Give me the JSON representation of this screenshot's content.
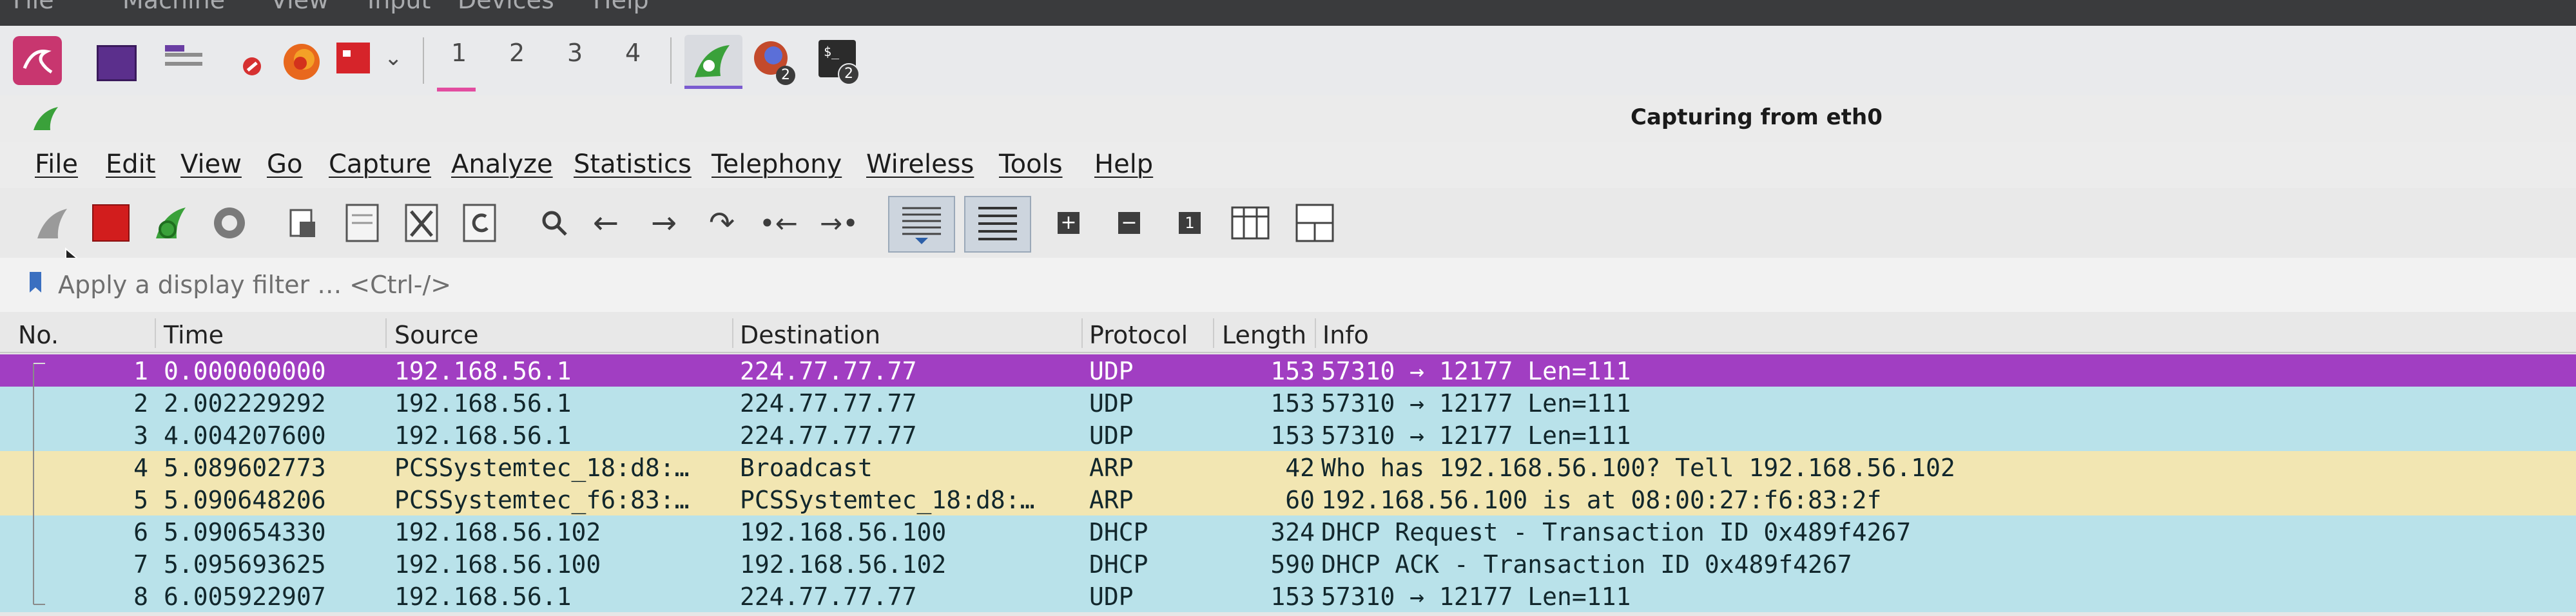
{
  "host_menu": {
    "items": [
      "File",
      "Machine",
      "View",
      "Input",
      "Devices",
      "Help"
    ]
  },
  "taskbar": {
    "workspaces": [
      "1",
      "2",
      "3",
      "4"
    ],
    "badges": [
      "2",
      "2"
    ],
    "icons": [
      "kali-menu-icon",
      "terminal-window-icon",
      "file-manager-icon",
      "text-editor-icon",
      "firefox-icon",
      "app-red-icon",
      "chevron-down-icon",
      "wireshark-task-icon",
      "firefox-task-icon",
      "terminal-task-icon"
    ]
  },
  "window": {
    "title": "Capturing from eth0"
  },
  "menu": {
    "items": [
      "File",
      "Edit",
      "View",
      "Go",
      "Capture",
      "Analyze",
      "Statistics",
      "Telephony",
      "Wireless",
      "Tools",
      "Help"
    ]
  },
  "toolbar": {
    "buttons": [
      "start-capture",
      "stop-capture",
      "restart-capture",
      "capture-options",
      "open-file",
      "save-file",
      "close-file",
      "reload-file",
      "find-packet",
      "go-back",
      "go-forward",
      "go-to-packet",
      "first-packet",
      "last-packet",
      "auto-scroll",
      "colorize",
      "zoom-in",
      "zoom-out",
      "normal-size",
      "resize-columns",
      "layout"
    ]
  },
  "filter": {
    "placeholder": "Apply a display filter … <Ctrl-/>"
  },
  "packet_list": {
    "headers": {
      "no": "No.",
      "time": "Time",
      "source": "Source",
      "destination": "Destination",
      "protocol": "Protocol",
      "length": "Length",
      "info": "Info"
    },
    "rows": [
      {
        "no": "1",
        "time": "0.000000000",
        "source": "192.168.56.1",
        "destination": "224.77.77.77",
        "protocol": "UDP",
        "length": "153",
        "info": "57310 → 12177 Len=111",
        "bg": "#a13ec2",
        "fg": "#ffffff",
        "selected": true
      },
      {
        "no": "2",
        "time": "2.002229292",
        "source": "192.168.56.1",
        "destination": "224.77.77.77",
        "protocol": "UDP",
        "length": "153",
        "info": "57310 → 12177 Len=111",
        "bg": "#b9e2ea",
        "fg": "#12272c",
        "selected": false
      },
      {
        "no": "3",
        "time": "4.004207600",
        "source": "192.168.56.1",
        "destination": "224.77.77.77",
        "protocol": "UDP",
        "length": "153",
        "info": "57310 → 12177 Len=111",
        "bg": "#b9e2ea",
        "fg": "#12272c",
        "selected": false
      },
      {
        "no": "4",
        "time": "5.089602773",
        "source": "PCSSystemtec_18:d8:…",
        "destination": "Broadcast",
        "protocol": "ARP",
        "length": "42",
        "info": "Who has 192.168.56.100? Tell 192.168.56.102",
        "bg": "#f2e6b2",
        "fg": "#12272c",
        "selected": false
      },
      {
        "no": "5",
        "time": "5.090648206",
        "source": "PCSSystemtec_f6:83:…",
        "destination": "PCSSystemtec_18:d8:…",
        "protocol": "ARP",
        "length": "60",
        "info": "192.168.56.100 is at 08:00:27:f6:83:2f",
        "bg": "#f2e6b2",
        "fg": "#12272c",
        "selected": false
      },
      {
        "no": "6",
        "time": "5.090654330",
        "source": "192.168.56.102",
        "destination": "192.168.56.100",
        "protocol": "DHCP",
        "length": "324",
        "info": "DHCP Request  - Transaction ID 0x489f4267",
        "bg": "#b9e2ea",
        "fg": "#12272c",
        "selected": false
      },
      {
        "no": "7",
        "time": "5.095693625",
        "source": "192.168.56.100",
        "destination": "192.168.56.102",
        "protocol": "DHCP",
        "length": "590",
        "info": "DHCP ACK      - Transaction ID 0x489f4267",
        "bg": "#b9e2ea",
        "fg": "#12272c",
        "selected": false
      },
      {
        "no": "8",
        "time": "6.005922907",
        "source": "192.168.56.1",
        "destination": "224.77.77.77",
        "protocol": "UDP",
        "length": "153",
        "info": "57310 → 12177 Len=111",
        "bg": "#b9e2ea",
        "fg": "#12272c",
        "selected": false
      }
    ]
  },
  "colors": {
    "selected_row": "#a13ec2",
    "udp_row": "#b9e2ea",
    "arp_row": "#f2e6b2",
    "accent_green": "#3aa13a"
  }
}
